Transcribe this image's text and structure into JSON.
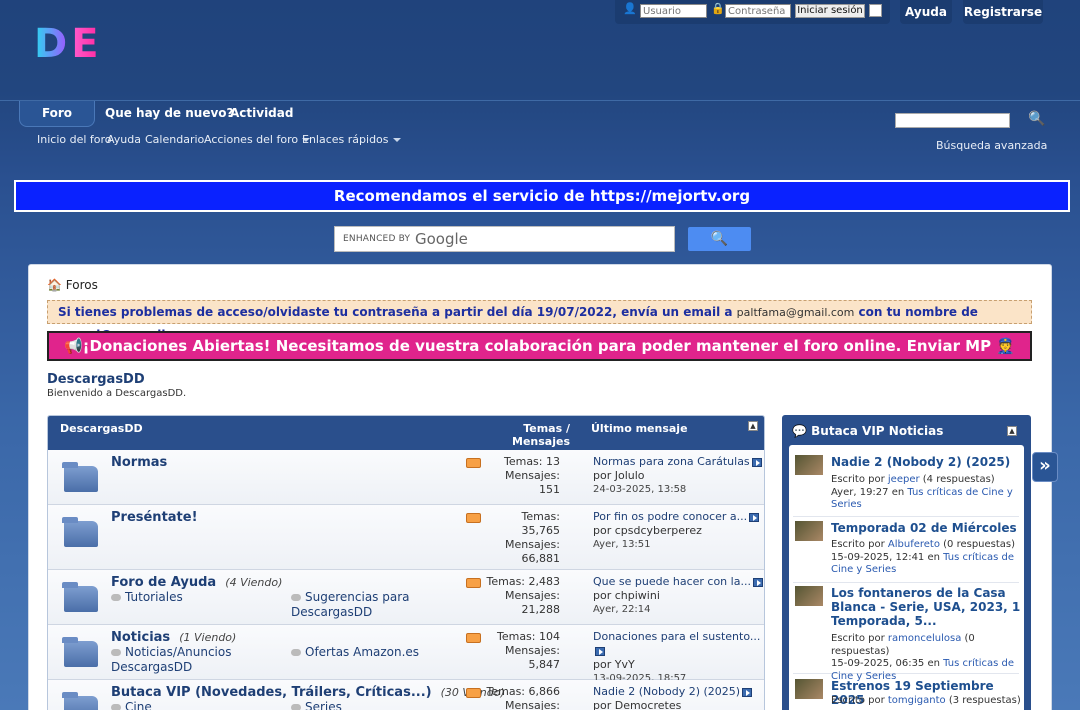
{
  "logo": {
    "text_d": "D",
    "text_e": "E"
  },
  "login": {
    "user_placeholder": "Usuario",
    "pass_placeholder": "Contraseña",
    "submit_label": "Iniciar sesión"
  },
  "top_buttons": {
    "help": "Ayuda",
    "register": "Registrarse"
  },
  "nav": {
    "tabs": [
      "Foro",
      "Que hay de nuevo?",
      "Actividad"
    ]
  },
  "subnav": {
    "items": [
      "Inicio del foro",
      "Ayuda",
      "Calendario",
      "Acciones del foro",
      "Enlaces rápidos"
    ]
  },
  "search": {
    "advanced": "Búsqueda avanzada"
  },
  "banner": {
    "text": "Recomendamos el servicio de https://mejortv.org"
  },
  "google": {
    "enhanced": "ENHANCED BY",
    "brand": "Google"
  },
  "breadcrumb": "Foros",
  "notice1": {
    "text_a": "Si tienes problemas de acceso/olvidaste tu contraseña a partir del día 19/07/2022, envía un email a ",
    "email": "paltfama@gmail.com",
    "text_b": " con tu nombre de usuari@ y email."
  },
  "notice2": {
    "text": "📢¡Donaciones Abiertas! Necesitamos de vuestra colaboración para poder mantener el foro online. Enviar MP 👮"
  },
  "forum": {
    "title": "DescargasDD",
    "subtitle": "Bienvenido a DescargasDD.",
    "headers": {
      "name": "DescargasDD",
      "stats": "Temas / Mensajes",
      "last": "Último mensaje"
    },
    "rows": [
      {
        "name": "Normas",
        "viewing": "",
        "subs": [],
        "temas": "Temas: 13",
        "mensajes_label": "Mensajes:",
        "mensajes": "151",
        "last_title": "Normas para zona Carátulas",
        "last_by": "por Jolulo",
        "last_date": "24-03-2025, 13:58"
      },
      {
        "name": "Preséntate!",
        "viewing": "",
        "subs": [],
        "temas": "Temas:",
        "temas_val": "35,765",
        "mensajes_label": "Mensajes:",
        "mensajes": "66,881",
        "last_title": "Por fin os podre conocer a...",
        "last_by": "por cpsdcyberperez",
        "last_date": "Ayer, 13:51"
      },
      {
        "name": "Foro de Ayuda",
        "viewing": "(4 Viendo)",
        "subs": [
          "Tutoriales",
          "Sugerencias para DescargasDD"
        ],
        "temas": "Temas: 2,483",
        "mensajes_label": "Mensajes:",
        "mensajes": "21,288",
        "last_title": "Que se puede hacer con la...",
        "last_by": "por chpiwini",
        "last_date": "Ayer, 22:14"
      },
      {
        "name": "Noticias",
        "viewing": "(1 Viendo)",
        "subs": [
          "Noticias/Anuncios DescargasDD",
          "Ofertas Amazon.es"
        ],
        "temas": "Temas: 104",
        "mensajes_label": "Mensajes:",
        "mensajes": "5,847",
        "last_title": "Donaciones para el sustento...",
        "last_by": "por YvY",
        "last_date": "13-09-2025, 18:57"
      },
      {
        "name": "Butaca VIP (Novedades, Tráilers, Críticas...)",
        "viewing": "(30 Viendo)",
        "subs": [
          "Cine",
          "Series"
        ],
        "temas": "Temas: 6,866",
        "mensajes_label": "Mensajes:",
        "mensajes": "",
        "last_title": "Nadie 2 (Nobody 2) (2025)",
        "last_by": "por Democretes",
        "last_date": ""
      }
    ]
  },
  "sidebar": {
    "title": "Butaca VIP Noticias",
    "items": [
      {
        "title": "Nadie 2 (Nobody 2) (2025)",
        "meta_a": "Escrito por ",
        "author": "jeeper",
        "meta_b": " (4 respuestas)",
        "date": "Ayer, 19:27 en ",
        "cat": "Tus críticas de Cine y Series"
      },
      {
        "title": "Temporada 02 de Miércoles",
        "meta_a": "Escrito por ",
        "author": "Albufereto",
        "meta_b": " (0 respuestas)",
        "date": "15-09-2025, 12:41 en ",
        "cat": "Tus críticas de Cine y Series"
      },
      {
        "title": "Los fontaneros de la Casa Blanca - Serie, USA, 2023, 1 Temporada, 5...",
        "meta_a": "Escrito por ",
        "author": "ramoncelulosa",
        "meta_b": " (0 respuestas)",
        "date": "15-09-2025, 06:35 en ",
        "cat": "Tus críticas de Cine y Series"
      },
      {
        "title": "Estrenos 19 Septiembre 2025",
        "meta_a": "Escrito por ",
        "author": "tomgiganto",
        "meta_b": " (3 respuestas)",
        "date": "",
        "cat": ""
      }
    ]
  }
}
